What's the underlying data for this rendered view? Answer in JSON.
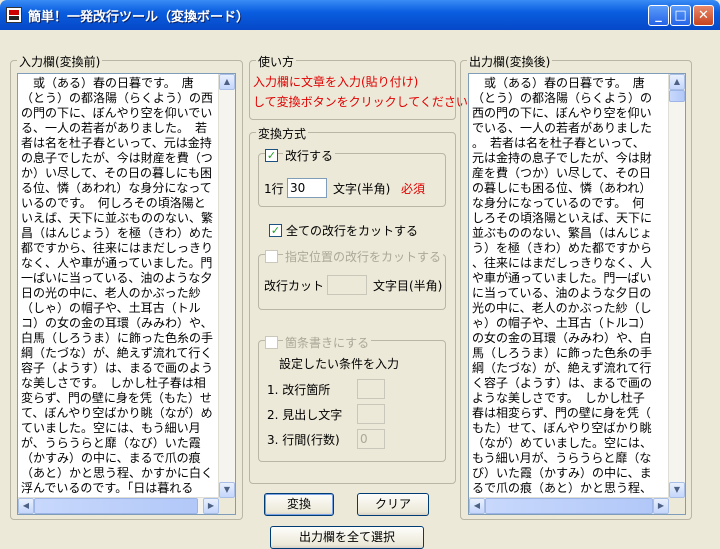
{
  "window": {
    "title": "簡単！一発改行ツール（変換ボード）",
    "min_label": "_",
    "max_label": "□",
    "close_label": "✕"
  },
  "input_panel": {
    "legend": "入力欄(変換前)",
    "text": "　或（ある）春の日暮です。　唐（とう）の都洛陽（らくよう）の西の門の下に、ぼんやり空を仰いでいる、一人の若者がありました。　若者は名を杜子春といって、元は金持の息子でしたが、今は財産を費（つか）い尽して、その日の暮しにも困る位、憐（あわれ）な身分になっているのです。　何しろその頃洛陽といえば、天下に並ぶもののない、繁昌（はんじょう）を極（きわ）めた都ですから、往来にはまだしっきりなく、人や車が通っていました。門一ぱいに当っている、油のような夕日の光の中に、老人のかぶった紗（しゃ）の帽子や、土耳古（トルコ）の女の金の耳環（みみわ）や、白馬（しろうま）に飾った色糸の手綱（たづな）が、絶えず流れて行く容子（ようす）は、まるで画のような美しさです。　しかし杜子春は相変らず、門の壁に身を凭（もた）せて、ぼんやり空ばかり眺（なが）めていました。空には、もう細い月が、うらうらと靡（なび）いた霞（かすみ）の中に、まるで爪の痕（あと）かと思う程、かすかに白く浮んでいるのです。「日は暮れるし、腹は減るし、その上もうどこへ行っても、泊めてくれる所はなさそうだし——こんな思いをして生きている位なら、一そ川へでも身を投げて、死んでしまった方がましかも知れない」"
  },
  "usage": {
    "legend": "使い方",
    "line1": "入力欄に文章を入力(貼り付け)",
    "line2": "して変換ボタンをクリックしてください"
  },
  "method": {
    "legend": "変換方式",
    "newline_checkbox": {
      "checked": true,
      "label": "改行する"
    },
    "per_line_label": "1行",
    "per_line_value": "30",
    "per_line_unit": "文字(半角)",
    "required_label": "必須",
    "cut_all_checkbox": {
      "checked": true,
      "label": "全ての改行をカットする"
    },
    "cut_position_group": {
      "checkbox_label": "指定位置の改行をカットする",
      "cut_label": "改行カット",
      "cut_value": "",
      "cut_unit": "文字目(半角)"
    },
    "bullet_group": {
      "checkbox_label": "箇条書きにする",
      "set_condition_label": "設定したい条件を入力",
      "fields": [
        {
          "label": "1. 改行箇所",
          "value": ""
        },
        {
          "label": "2. 見出し文字",
          "value": ""
        },
        {
          "label": "3. 行間(行数)",
          "value": "0"
        }
      ]
    }
  },
  "buttons": {
    "convert": "変換",
    "clear": "クリア",
    "select_all_output": "出力欄を全て選択"
  },
  "output_panel": {
    "legend": "出力欄(変換後)",
    "text": "　或（ある）春の日暮です。　唐\n（とう）の都洛陽（らくよう）の\n西の門の下に、ぼんやり空を仰い\nでいる、一人の若者がありました\n。　若者は名を杜子春といって、\n元は金持の息子でしたが、今は財\n産を費（つか）い尽して、その日\nの暮しにも困る位、憐（あわれ）\nな身分になっているのです。　何\nしろその頃洛陽といえば、天下に\n並ぶもののない、繁昌（はんじょ\nう）を極（きわ）めた都ですから\n、往来にはまだしっきりなく、人\nや車が通っていました。門一ぱい\nに当っている、油のような夕日の\n光の中に、老人のかぶった紗（し\nゃ）の帽子や、土耳古（トルコ）\nの女の金の耳環（みみわ）や、白\n馬（しろうま）に飾った色糸の手\n綱（たづな）が、絶えず流れて行\nく容子（ようす）は、まるで画の\nような美しさです。　しかし杜子\n春は相変らず、門の壁に身を凭（\nもた）せて、ぼんやり空ばかり眺\n（なが）めていました。空には、\nもう細い月が、うらうらと靡（な\nび）いた霞（かすみ）の中に、ま\nるで爪の痕（あと）かと思う程、\nかすかに白く浮んでいるのです。\n「日は暮れるし、腹は減るし、そ\nの上もうどこへ行っても、泊めて\nくれる所はなさそうだし——こん\nな思いをして生きている位なら、\n一そ川へでも身を投げて、死んで\nしまった方がましかも知れない」"
  }
}
